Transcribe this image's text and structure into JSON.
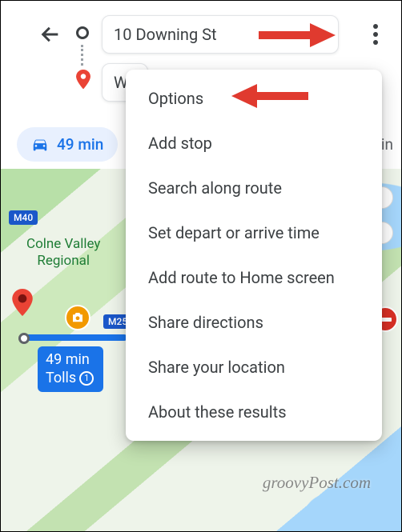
{
  "header": {
    "origin_value": "10 Downing St",
    "destination_value": "W"
  },
  "mode_chip": {
    "time": "49 min"
  },
  "partial_chip_suffix": "in",
  "dropdown": {
    "items": [
      "Options",
      "Add stop",
      "Search along route",
      "Set depart or arrive time",
      "Add route to Home screen",
      "Share directions",
      "Share your location",
      "About these results"
    ]
  },
  "map": {
    "road_labels": {
      "m40": "M40",
      "m25": "M25"
    },
    "park_label_line1": "Colne Valley",
    "park_label_line2": "Regional",
    "route_badge_time": "49 min",
    "route_badge_tolls": "Tolls",
    "route_badge_count": "1"
  },
  "watermark": "groovyPost.com"
}
